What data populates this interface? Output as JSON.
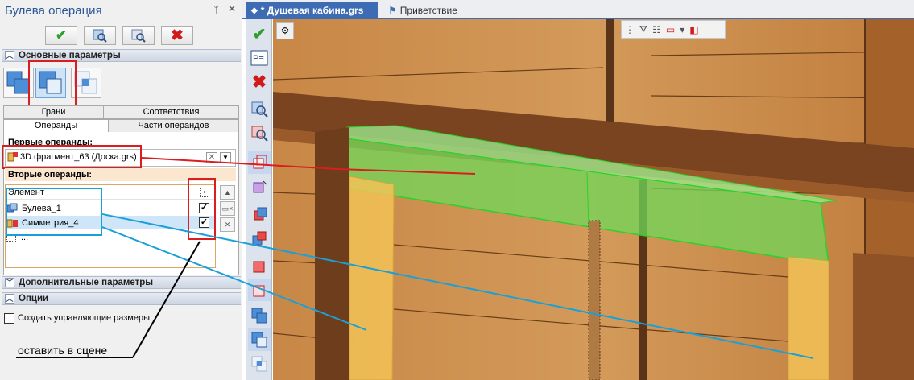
{
  "panel": {
    "title": "Булева операция",
    "title_icons": [
      "pin-icon",
      "close-icon"
    ],
    "pin_glyph": "ᛘ",
    "close_glyph": "✕",
    "toolbar": [
      {
        "name": "ok-button",
        "glyph": "✔",
        "color": "#2e9e2e"
      },
      {
        "name": "preview-button",
        "glyph": "🔍"
      },
      {
        "name": "preview-alt-button",
        "glyph": "🔎"
      },
      {
        "name": "cancel-button",
        "glyph": "✖",
        "color": "#d11b1b"
      }
    ],
    "main_params": "Основные параметры",
    "tabs_top": [
      "Грани",
      "Соответствия"
    ],
    "tabs_bottom": [
      "Операнды",
      "Части операндов"
    ],
    "first_operands_label": "Первые операнды:",
    "first_operand_value": "3D фрагмент_63 (Доска.grs)",
    "second_operands_label": "Вторые операнды:",
    "list_header": "Элемент",
    "rows": [
      {
        "label": "Булева_1",
        "checked": true
      },
      {
        "label": "Симметрия_4",
        "checked": true
      },
      {
        "label": "...",
        "checked": false
      }
    ],
    "additional_params": "Дополнительные параметры",
    "options": "Опции",
    "create_dims": "Создать управляющие размеры",
    "annotation": "оставить в сцене"
  },
  "doc_tabs": {
    "active": "* Душевая кабина.grs",
    "inactive": "Приветствие"
  },
  "colors": {
    "accent": "#3d6cb5",
    "annotation_red": "#d81e1e",
    "annotation_blue": "#1aa0d8",
    "wood": "#c98a4a",
    "green_highlight": "#6fd85a",
    "yellow_highlight": "#f2c257"
  }
}
